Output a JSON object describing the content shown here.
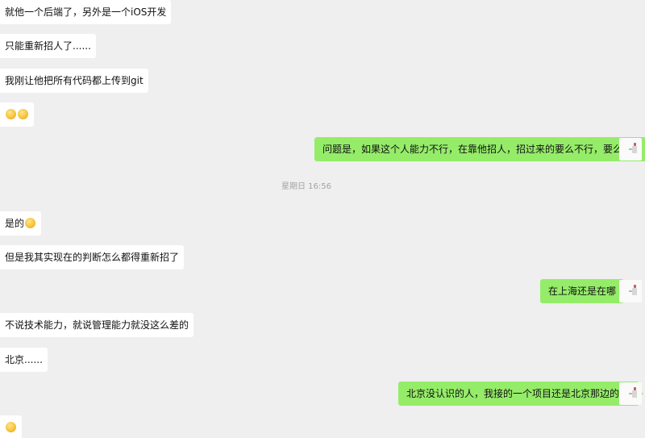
{
  "conversation": {
    "timestamp": "星期日 16:56",
    "messages": [
      {
        "side": "in",
        "text": "就他一个后端了，另外是一个iOS开发"
      },
      {
        "side": "in",
        "text": "只能重新招人了......"
      },
      {
        "side": "in",
        "text": "我刚让他把所有代码都上传到git"
      },
      {
        "side": "in",
        "text": "",
        "emoji": [
          "face-emoji",
          "face-emoji"
        ]
      },
      {
        "side": "out",
        "text": "问题是，如果这个人能力不行，在靠他招人，招过来的要么不行，要么不服"
      },
      {
        "side": "in",
        "text": "是的",
        "emoji": [
          "face-emoji"
        ]
      },
      {
        "side": "in",
        "text": "但是我其实现在的判断怎么都得重新招了"
      },
      {
        "side": "out",
        "text": "在上海还是在哪"
      },
      {
        "side": "in",
        "text": "不说技术能力，就说管理能力就没这么差的"
      },
      {
        "side": "in",
        "text": "北京......"
      },
      {
        "side": "out",
        "text": "北京没认识的人，我接的一个项目还是北京那边的",
        "emoji": [
          "blush-emoji"
        ]
      },
      {
        "side": "in",
        "text": "",
        "emoji": [
          "face-emoji"
        ]
      }
    ]
  },
  "colors": {
    "background": "#efefef",
    "incoming_bubble": "#ffffff",
    "outgoing_bubble": "#95ec69",
    "timestamp_text": "#a3a3a3"
  }
}
